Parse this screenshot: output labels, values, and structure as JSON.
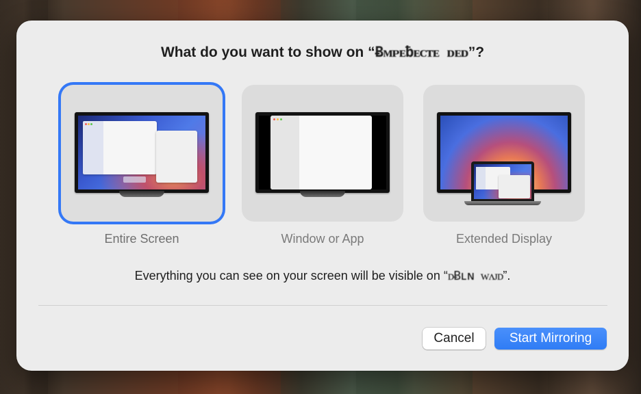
{
  "dialog": {
    "title_prefix": "What do you want to show on “",
    "title_device": "Ƀᴍᴘᴇƀᴇᴄᴛᴇ ᴅᴇᴅ",
    "title_suffix": "”?",
    "description_prefix": "Everything you can see on your screen will be visible on “",
    "description_device": "ᴅɃʟɴ ᴡᴧᴊᴅ",
    "description_suffix": "”."
  },
  "options": [
    {
      "label": "Entire Screen",
      "selected": true
    },
    {
      "label": "Window or App",
      "selected": false
    },
    {
      "label": "Extended Display",
      "selected": false
    }
  ],
  "buttons": {
    "cancel": "Cancel",
    "start": "Start Mirroring"
  },
  "colors": {
    "accent": "#3478f6",
    "dialog_bg": "#ececec",
    "option_bg": "#dcdcdc",
    "label_gray": "#7a7a7a"
  }
}
